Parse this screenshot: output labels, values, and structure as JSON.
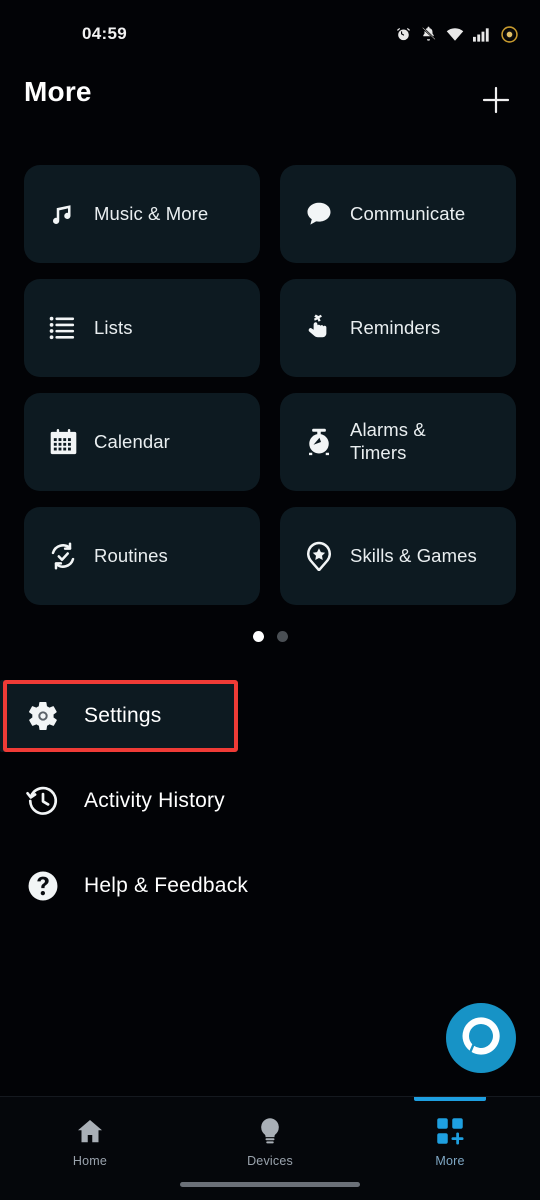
{
  "status_bar": {
    "time": "04:59",
    "icons": [
      "alarm-icon",
      "bell-muted-icon",
      "wifi-icon",
      "cellular-signal-icon",
      "battery-circle-icon"
    ]
  },
  "header": {
    "title": "More",
    "add_button": "add-icon"
  },
  "grid": {
    "tiles": [
      {
        "label": "Music & More",
        "icon": "music-note-icon"
      },
      {
        "label": "Communicate",
        "icon": "speech-bubble-icon"
      },
      {
        "label": "Lists",
        "icon": "list-lines-icon"
      },
      {
        "label": "Reminders",
        "icon": "finger-string-icon"
      },
      {
        "label": "Calendar",
        "icon": "calendar-icon"
      },
      {
        "label": "Alarms &\nTimers",
        "icon": "alarm-clock-icon"
      },
      {
        "label": "Routines",
        "icon": "routines-refresh-check-icon"
      },
      {
        "label": "Skills & Games",
        "icon": "pin-star-icon"
      }
    ]
  },
  "pager": {
    "total": 2,
    "active_index": 0
  },
  "list": {
    "items": [
      {
        "label": "Settings",
        "icon": "gear-icon",
        "highlighted": true
      },
      {
        "label": "Activity History",
        "icon": "history-clock-icon",
        "highlighted": false
      },
      {
        "label": "Help & Feedback",
        "icon": "question-mark-circle-icon",
        "highlighted": false
      }
    ]
  },
  "fab": {
    "name": "alexa-button",
    "icon": "alexa-ring-icon"
  },
  "bottom_nav": {
    "items": [
      {
        "label": "Home",
        "icon": "home-icon",
        "active": false
      },
      {
        "label": "Devices",
        "icon": "lightbulb-icon",
        "active": false
      },
      {
        "label": "More",
        "icon": "grid-plus-icon",
        "active": true
      }
    ]
  },
  "colors": {
    "background": "#020306",
    "tile_background": "#0d1a21",
    "accent_blue": "#1e9fe0",
    "alexa_blue": "#1793c6",
    "highlight_red": "#ef3b36",
    "text_primary": "#ffffff",
    "text_secondary": "#9aa3ad"
  }
}
